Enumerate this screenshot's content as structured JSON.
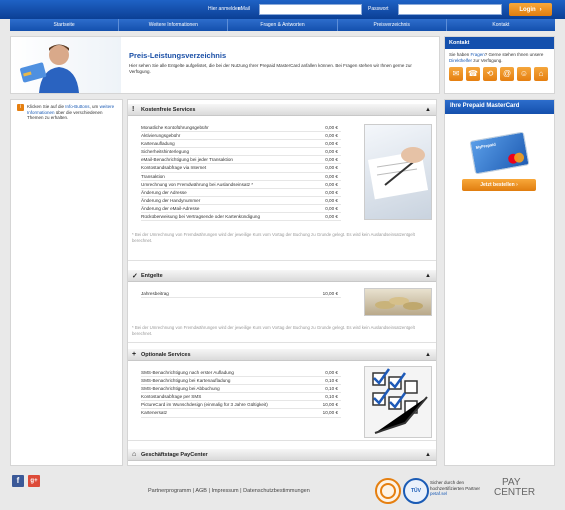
{
  "header": {
    "login_prompt": "Hier anmelden:",
    "email_label": "eMail",
    "password_label": "Passwort",
    "login_button": "Login"
  },
  "nav": [
    "Startseite",
    "Weitere Informationen",
    "Fragen & Antworten",
    "Preisverzeichnis",
    "Kontakt"
  ],
  "hero": {
    "title": "Preis-Leistungsverzeichnis",
    "text": "Hier sehen Sie alle Entgelte aufgelistet, die bei der Nutzung Ihrer Prepaid MasterCard anfallen können. Bei Fragen stehen wir Ihnen gerne zur Verfügung."
  },
  "kontakt": {
    "title": "Kontakt",
    "text_a": "Sie haben ",
    "link_fragen": "Fragen",
    "text_b": "? Gerne stehen Ihnen unsere ",
    "link_direkt": "Direkthelfer",
    "text_c": " zur Verfügung.",
    "icons": [
      "mail-icon",
      "phone-icon",
      "callback-icon",
      "at-icon",
      "chat-icon",
      "home-icon"
    ]
  },
  "left_tip": {
    "text_a": "Klicken Sie auf die ",
    "link1": "Info-Buttons",
    "text_b": ", um ",
    "link2": "weitere Informationen",
    "text_c": " über die verschiedenen Themen zu erhalten."
  },
  "sections": {
    "kostenfrei": {
      "title": "Kostenfreie Services",
      "rows": [
        {
          "name": "Monatliche Kontoführungsgebühr",
          "value": "0,00 €"
        },
        {
          "name": "Aktivierungsgebühr",
          "value": "0,00 €"
        },
        {
          "name": "Kartenaufladung",
          "value": "0,00 €"
        },
        {
          "name": "Sicherheitshinterlegung",
          "value": "0,00 €"
        },
        {
          "name": "eMail-Benachrichtigung bei jeder Transaktion",
          "value": "0,00 €"
        },
        {
          "name": "Kontostandsabfrage via Internet",
          "value": "0,00 €"
        },
        {
          "name": "Transaktion",
          "value": "0,00 €"
        },
        {
          "name": "Umrechnung von Fremdwährung bei Auslandseinsatz *",
          "value": "0,00 €"
        },
        {
          "name": "Änderung der Adresse",
          "value": "0,00 €"
        },
        {
          "name": "Änderung der Handynummer",
          "value": "0,00 €"
        },
        {
          "name": "Änderung der eMail-Adresse",
          "value": "0,00 €"
        },
        {
          "name": "Rücküberweisung bei Vertragsende oder Kartenkündigung",
          "value": "0,00 €"
        }
      ],
      "note": "* Bei der Umrechnung von Fremdwährungen wird der jeweilige Kurs vom Vortag der Buchung zu Grunde gelegt. Es wird kein Auslandseinsatzentgelt berechnet."
    },
    "entgelte": {
      "title": "Entgelte",
      "rows": [
        {
          "name": "Jahresbeitrag",
          "value": "10,00 €"
        }
      ],
      "note": "* Bei der Umrechnung von Fremdwährungen wird der jeweilige Kurs vom Vortag der Buchung zu Grunde gelegt. Es wird kein Auslandseinsatzentgelt berechnet."
    },
    "optional": {
      "title": "Optionale Services",
      "rows": [
        {
          "name": "SMS-Benachrichtigung nach erster Aufladung",
          "value": "0,00 €"
        },
        {
          "name": "SMS-Benachrichtigung bei Kartenaufladung",
          "value": "0,10 €"
        },
        {
          "name": "SMS-Benachrichtigung bei Abbuchung",
          "value": "0,10 €"
        },
        {
          "name": "Kontostandsabfrage per SMS",
          "value": "0,10 €"
        },
        {
          "name": "PictureCard im Wunschdesign (einmalig für 3 Jahre Gültigkeit)",
          "value": "10,00 €"
        },
        {
          "name": "Kartenersatz",
          "value": "10,00 €"
        }
      ]
    },
    "geschaeftstage": {
      "title": "Geschäftstage PayCenter"
    }
  },
  "promo": {
    "title": "Ihre Prepaid MasterCard",
    "card_text": "MyPrepaid",
    "button": "Jetzt bestellen"
  },
  "footer": {
    "links": [
      "Partnerprogramm",
      "AGB",
      "Impressum",
      "Datenschutzbestimmungen"
    ],
    "separator": "|",
    "seal_text": "Sicher durch den hochzertifizierten Partner ",
    "seal_link": "petaf.sel",
    "logo_pay": "PAY",
    "logo_center": "CENTER",
    "tuev": "TÜV"
  },
  "colors": {
    "brand_blue": "#1450ad",
    "accent_orange": "#e57f10"
  }
}
